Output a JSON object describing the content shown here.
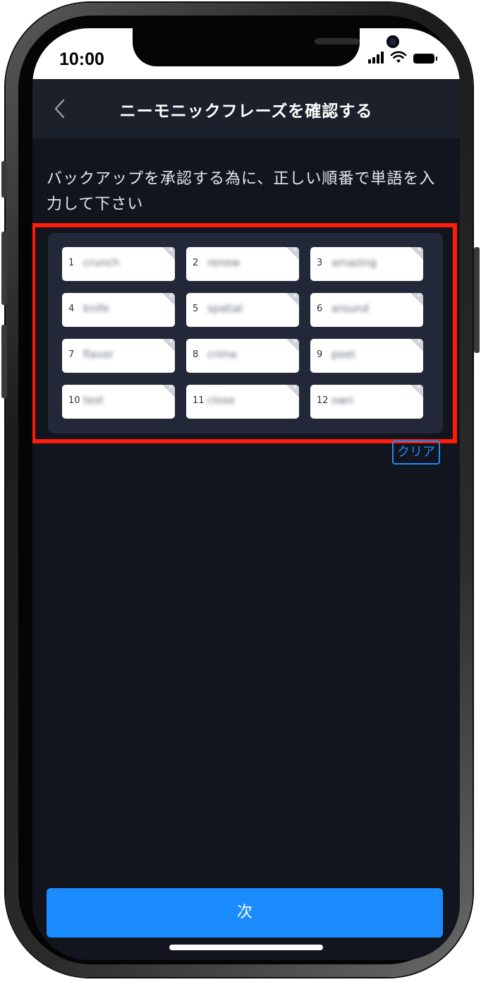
{
  "status_bar": {
    "time": "10:00"
  },
  "nav": {
    "title": "ニーモニックフレーズを確認する"
  },
  "instruction": "バックアップを承認する為に、正しい順番で単語を入力して下さい",
  "words": [
    {
      "num": "1",
      "word": "crunch"
    },
    {
      "num": "2",
      "word": "renew"
    },
    {
      "num": "3",
      "word": "amazing"
    },
    {
      "num": "4",
      "word": "knife"
    },
    {
      "num": "5",
      "word": "spatial"
    },
    {
      "num": "6",
      "word": "around"
    },
    {
      "num": "7",
      "word": "flavor"
    },
    {
      "num": "8",
      "word": "crime"
    },
    {
      "num": "9",
      "word": "poet"
    },
    {
      "num": "10",
      "word": "test"
    },
    {
      "num": "11",
      "word": "close"
    },
    {
      "num": "12",
      "word": "own"
    }
  ],
  "remove_glyph": "×",
  "clear_label": "クリア",
  "next_label": "次",
  "icons": {
    "back": "chevron-left-icon",
    "signal": "cellular-signal-icon",
    "wifi": "wifi-icon",
    "battery": "battery-icon",
    "remove": "close-icon"
  },
  "colors": {
    "background": "#12151d",
    "navbar": "#1b202b",
    "panel": "#232838",
    "accent": "#1a8cff",
    "highlight": "#ff1a0a"
  }
}
